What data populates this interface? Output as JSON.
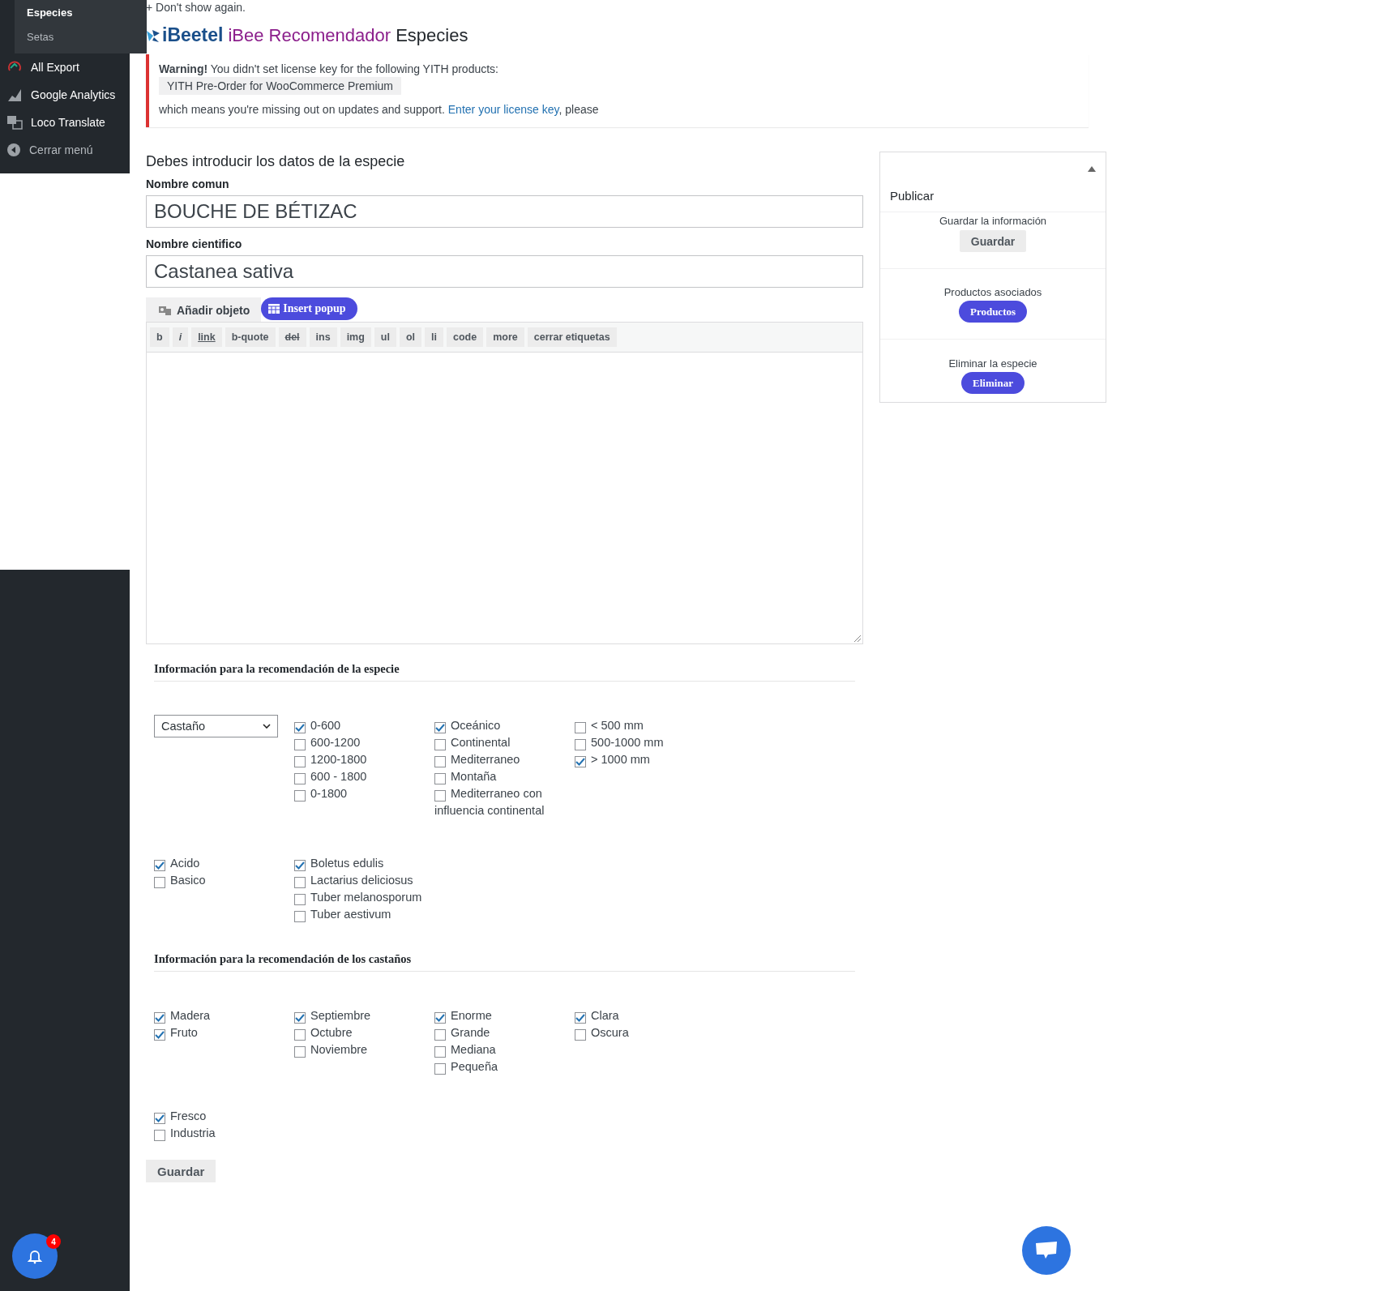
{
  "sidebar": {
    "submenu": [
      {
        "label": "Especies",
        "selected": true
      },
      {
        "label": "Setas",
        "selected": false
      }
    ],
    "items": [
      {
        "label": "All Export",
        "kind": "export"
      },
      {
        "label": "Google Analytics",
        "kind": "analytics"
      },
      {
        "label": "Loco Translate",
        "kind": "translate"
      },
      {
        "label": "Cerrar menú",
        "kind": "collapse"
      }
    ]
  },
  "top_notice": "+ Don't show again.",
  "header": {
    "logo": "iBeetel",
    "title_highlight": "iBee Recomendador",
    "title": "Especies"
  },
  "warning": {
    "label": "Warning!",
    "text": "You didn't set license key for the following YITH products:",
    "product": "YITH Pre-Order for WooCommerce Premium",
    "text2": "which means you're missing out on updates and support.",
    "link": "Enter your license key",
    "text3": ", please"
  },
  "form": {
    "heading": "Debes introducir los datos de la especie",
    "fields": [
      {
        "label": "Nombre comun",
        "value": "BOUCHE DE BÉTIZAC"
      },
      {
        "label": "Nombre cientifico",
        "value": "Castanea sativa"
      }
    ],
    "media_button": "Añadir objeto",
    "popup_button": "Insert popup",
    "toolbar": [
      {
        "label": "b",
        "kind": "bold"
      },
      {
        "label": "i",
        "kind": "italic"
      },
      {
        "label": "link",
        "kind": "link"
      },
      {
        "label": "b-quote",
        "kind": "plain"
      },
      {
        "label": "del",
        "kind": "strike"
      },
      {
        "label": "ins",
        "kind": "plain"
      },
      {
        "label": "img",
        "kind": "plain"
      },
      {
        "label": "ul",
        "kind": "plain"
      },
      {
        "label": "ol",
        "kind": "plain"
      },
      {
        "label": "li",
        "kind": "plain"
      },
      {
        "label": "code",
        "kind": "plain"
      },
      {
        "label": "more",
        "kind": "plain"
      },
      {
        "label": "cerrar etiquetas",
        "kind": "plain"
      }
    ]
  },
  "sections": [
    {
      "title": "Información para la recomendación de la especie",
      "rows": [
        {
          "select": "Castaño",
          "groups": [
            [
              {
                "label": "0-600",
                "checked": true
              },
              {
                "label": "600-1200",
                "checked": false
              },
              {
                "label": "1200-1800",
                "checked": false
              },
              {
                "label": "600 - 1800",
                "checked": false
              },
              {
                "label": "0-1800",
                "checked": false
              }
            ],
            [
              {
                "label": "Oceánico",
                "checked": true
              },
              {
                "label": "Continental",
                "checked": false
              },
              {
                "label": "Mediterraneo",
                "checked": false
              },
              {
                "label": "Montaña",
                "checked": false
              },
              {
                "label": "Mediterraneo con influencia continental",
                "checked": false
              }
            ],
            [
              {
                "label": "< 500 mm",
                "checked": false
              },
              {
                "label": "500-1000 mm",
                "checked": false
              },
              {
                "label": "> 1000 mm",
                "checked": true
              }
            ]
          ]
        },
        {
          "groups": [
            [
              {
                "label": "Acido",
                "checked": true
              },
              {
                "label": "Basico",
                "checked": false
              }
            ],
            [
              {
                "label": "Boletus edulis",
                "checked": true
              },
              {
                "label": "Lactarius deliciosus",
                "checked": false
              },
              {
                "label": "Tuber melanosporum",
                "checked": false
              },
              {
                "label": "Tuber aestivum",
                "checked": false
              }
            ]
          ]
        }
      ]
    },
    {
      "title": "Información para la recomendación de los castaños",
      "rows": [
        {
          "groups": [
            [
              {
                "label": "Madera",
                "checked": true
              },
              {
                "label": "Fruto",
                "checked": true
              }
            ],
            [
              {
                "label": "Septiembre",
                "checked": true
              },
              {
                "label": "Octubre",
                "checked": false
              },
              {
                "label": "Noviembre",
                "checked": false
              }
            ],
            [
              {
                "label": "Enorme",
                "checked": true
              },
              {
                "label": "Grande",
                "checked": false
              },
              {
                "label": "Mediana",
                "checked": false
              },
              {
                "label": "Pequeña",
                "checked": false
              }
            ],
            [
              {
                "label": "Clara",
                "checked": true
              },
              {
                "label": "Oscura",
                "checked": false
              }
            ]
          ]
        },
        {
          "groups": [
            [
              {
                "label": "Fresco",
                "checked": true
              },
              {
                "label": "Industria",
                "checked": false
              }
            ]
          ]
        }
      ]
    }
  ],
  "save_button": "Guardar",
  "publish_box": {
    "title": "Publicar",
    "sections": [
      {
        "label": "Guardar la información",
        "button": "Guardar",
        "kind": "grey"
      },
      {
        "label": "Productos asociados",
        "button": "Productos",
        "kind": "purple"
      },
      {
        "label": "Eliminar la especie",
        "button": "Eliminar",
        "kind": "purple"
      }
    ]
  },
  "notifications": {
    "count": "4"
  }
}
